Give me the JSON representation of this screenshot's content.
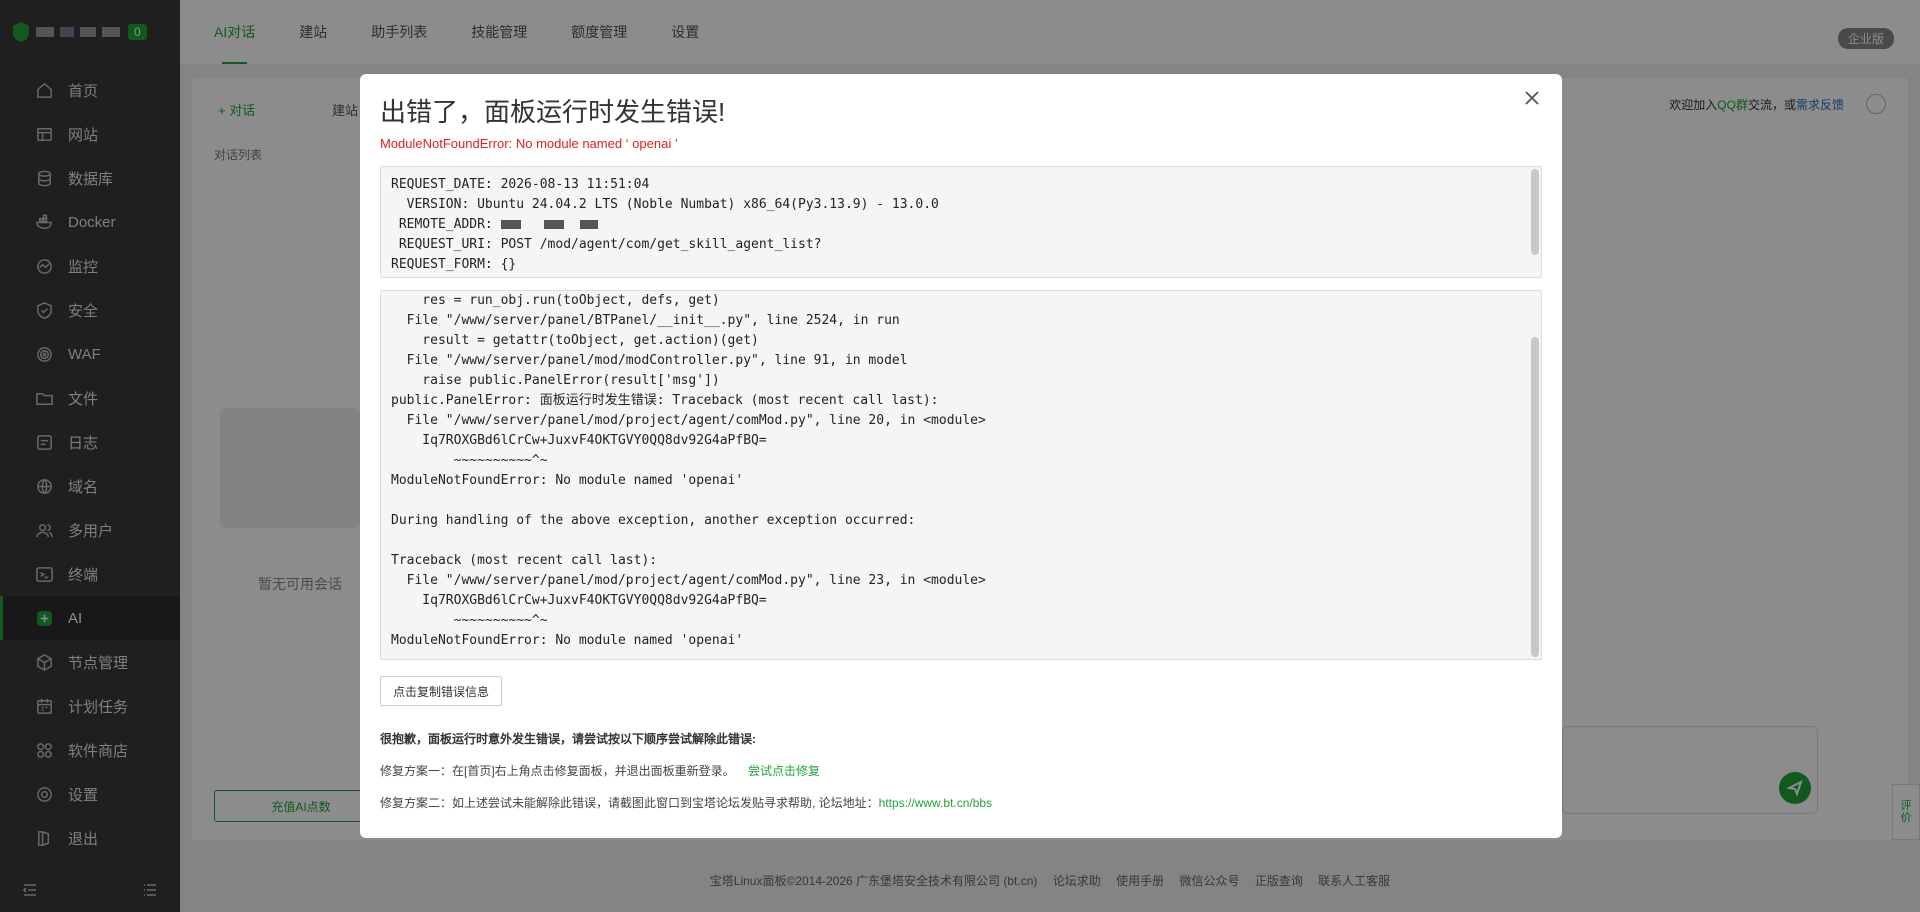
{
  "sidebar": {
    "badge": "0",
    "items": [
      {
        "label": "首页",
        "icon": "home-icon"
      },
      {
        "label": "网站",
        "icon": "website-icon"
      },
      {
        "label": "数据库",
        "icon": "database-icon"
      },
      {
        "label": "Docker",
        "icon": "docker-icon"
      },
      {
        "label": "监控",
        "icon": "monitor-icon"
      },
      {
        "label": "安全",
        "icon": "shield-icon"
      },
      {
        "label": "WAF",
        "icon": "waf-icon"
      },
      {
        "label": "文件",
        "icon": "folder-icon"
      },
      {
        "label": "日志",
        "icon": "log-icon"
      },
      {
        "label": "域名",
        "icon": "globe-icon"
      },
      {
        "label": "多用户",
        "icon": "users-icon"
      },
      {
        "label": "终端",
        "icon": "terminal-icon"
      },
      {
        "label": "AI",
        "icon": "ai-icon"
      },
      {
        "label": "节点管理",
        "icon": "node-icon"
      },
      {
        "label": "计划任务",
        "icon": "calendar-icon"
      },
      {
        "label": "软件商店",
        "icon": "store-icon"
      },
      {
        "label": "设置",
        "icon": "gear-icon"
      },
      {
        "label": "退出",
        "icon": "logout-icon"
      }
    ]
  },
  "topbar": {
    "tabs": [
      "AI对话",
      "建站",
      "助手列表",
      "技能管理",
      "额度管理",
      "设置"
    ],
    "enterprise": "企业版"
  },
  "background": {
    "new_chat": "+ 对话",
    "tab2": "建站",
    "list_title": "对话列表",
    "empty": "暂无可用会话",
    "recharge": "充值AI点数",
    "qq_prefix": "欢迎加入",
    "qq_group": "QQ群",
    "qq_mid": "交流，或",
    "qq_feedback": "需求反馈",
    "feedback_side": [
      "评",
      "价"
    ]
  },
  "footer": {
    "copyright": "宝塔Linux面板©2014-2026 广东堡塔安全技术有限公司 (bt.cn)",
    "links": [
      "论坛求助",
      "使用手册",
      "微信公众号",
      "正版查询",
      "联系人工客服"
    ]
  },
  "modal": {
    "title": "出错了，面板运行时发生错误!",
    "error_line": "ModuleNotFoundError: No module named ‘ openai ’",
    "box1": {
      "request_date_label": "REQUEST_DATE: ",
      "request_date": "2026-08-13 11:51:04",
      "version_label": "  VERSION: ",
      "version": "Ubuntu 24.04.2 LTS (Noble Numbat) x86_64(Py3.13.9) - 13.0.0",
      "remote_addr_label": " REMOTE_ADDR: ",
      "request_uri_label": " REQUEST_URI: ",
      "request_uri": "POST /mod/agent/com/get_skill_agent_list?",
      "request_form_label": "REQUEST_FORM: ",
      "request_form": "{}"
    },
    "traceback": [
      "    res = run_obj.run(toObject, defs, get)",
      "  File \"/www/server/panel/BTPanel/__init__.py\", line 2524, in run",
      "    result = getattr(toObject, get.action)(get)",
      "  File \"/www/server/panel/mod/modController.py\", line 91, in model",
      "    raise public.PanelError(result['msg'])",
      "public.PanelError: 面板运行时发生错误: Traceback (most recent call last):",
      "  File \"/www/server/panel/mod/project/agent/comMod.py\", line 20, in <module>",
      "    Iq7ROXGBd6lCrCw+JuxvF4OKTGVY0QQ8dv92G4aPfBQ=",
      "        ~~~~~~~~~~^~",
      "ModuleNotFoundError: No module named 'openai'",
      "",
      "During handling of the above exception, another exception occurred:",
      "",
      "Traceback (most recent call last):",
      "  File \"/www/server/panel/mod/project/agent/comMod.py\", line 23, in <module>",
      "    Iq7ROXGBd6lCrCw+JuxvF4OKTGVY0QQ8dv92G4aPfBQ=",
      "        ~~~~~~~~~~^~",
      "ModuleNotFoundError: No module named 'openai'"
    ],
    "copy_button": "点击复制错误信息",
    "sorry": "很抱歉，面板运行时意外发生错误，请尝试按以下顺序尝试解除此错误:",
    "fix1": "修复方案一：在[首页]右上角点击修复面板，并退出面板重新登录。",
    "fix1_link": "尝试点击修复",
    "fix2": "修复方案二：如上述尝试未能解除此错误，请截图此窗口到宝塔论坛发贴寻求帮助, 论坛地址：",
    "fix2_link": "https://www.bt.cn/bbs"
  },
  "colors": {
    "accent": "#20a53a",
    "error": "#e02020",
    "sidebar_bg": "#3a3a3a"
  }
}
